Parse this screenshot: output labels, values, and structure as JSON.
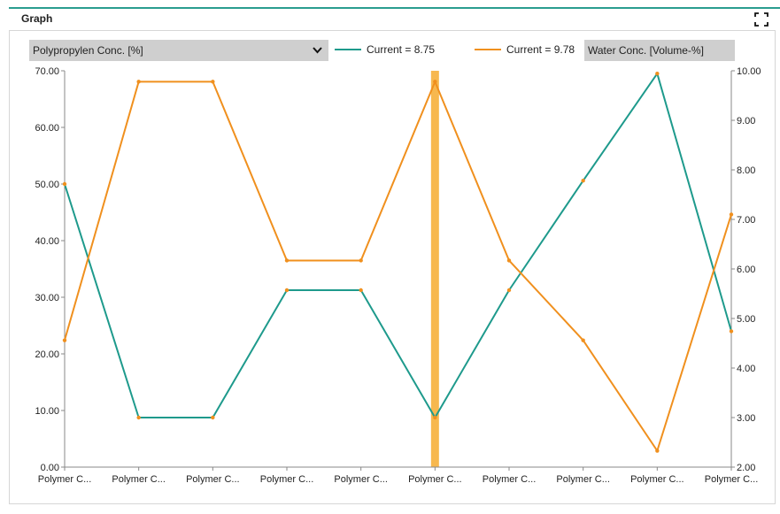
{
  "panel": {
    "title": "Graph"
  },
  "icons": {
    "expand": "expand-icon",
    "dropdown": "chevron-down-icon"
  },
  "controls": {
    "left_axis_select": "Polypropylen Conc. [%]",
    "right_axis_select": "Water Conc. [Volume-%]"
  },
  "legend": [
    {
      "label": "Current = 8.75",
      "color": "#1e9a8c"
    },
    {
      "label": "Current = 9.78",
      "color": "#f0901e"
    }
  ],
  "chart_data": {
    "type": "line",
    "categories": [
      "Polymer C...",
      "Polymer C...",
      "Polymer C...",
      "Polymer C...",
      "Polymer C...",
      "Polymer C...",
      "Polymer C...",
      "Polymer C...",
      "Polymer C...",
      "Polymer C..."
    ],
    "y_left": {
      "ylim": [
        0,
        70
      ],
      "ticks": [
        "0.00",
        "10.00",
        "20.00",
        "30.00",
        "40.00",
        "50.00",
        "60.00",
        "70.00"
      ]
    },
    "y_right": {
      "ylim": [
        2,
        10
      ],
      "ticks": [
        "2.00",
        "3.00",
        "4.00",
        "5.00",
        "6.00",
        "7.00",
        "8.00",
        "9.00",
        "10.00"
      ]
    },
    "series": [
      {
        "axis": "left",
        "color": "#1e9a8c",
        "values": [
          50.0,
          8.75,
          8.75,
          31.25,
          31.25,
          8.75,
          31.25,
          50.6,
          69.5,
          24.0
        ]
      },
      {
        "axis": "right",
        "color": "#f0901e",
        "values": [
          4.56,
          9.78,
          9.78,
          6.17,
          6.17,
          9.78,
          6.17,
          4.56,
          2.33,
          7.1
        ]
      }
    ],
    "highlight_index": 5,
    "highlight_color": "#f7b84f"
  }
}
